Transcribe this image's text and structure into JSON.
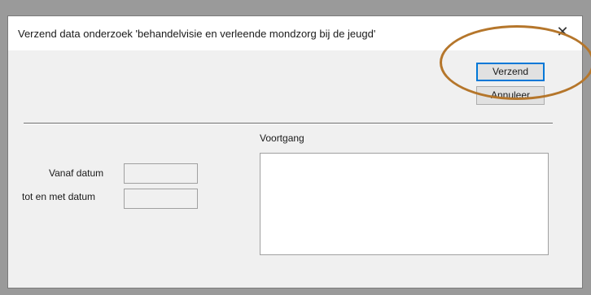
{
  "dialog": {
    "title": "Verzend data onderzoek 'behandelvisie en verleende mondzorg bij de jeugd'",
    "close_glyph": "✕"
  },
  "buttons": {
    "send_label": "Verzend",
    "cancel_label": "Annuleer"
  },
  "form": {
    "from_date_label": "Vanaf datum",
    "from_date_value": "",
    "to_date_label": "tot en met datum",
    "to_date_value": ""
  },
  "progress": {
    "label": "Voortgang",
    "content": ""
  },
  "colors": {
    "accent": "#0078d7",
    "highlight_ring": "#b5762b"
  },
  "icons": {
    "close": "close-icon"
  }
}
